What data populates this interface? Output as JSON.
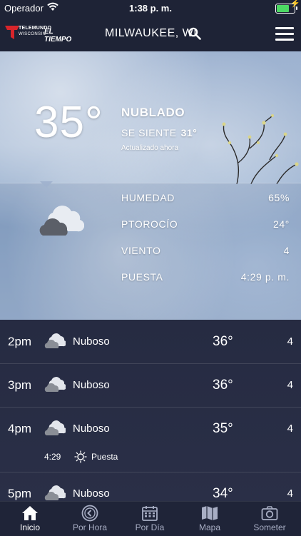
{
  "status": {
    "carrier": "Operador",
    "time": "1:38 p. m."
  },
  "header": {
    "brand_top": "TELEMUNDO",
    "brand_bottom": "WISCONSIN",
    "brand_right": "EL TIEMPO",
    "location": "MILWAUKEE, WI"
  },
  "current": {
    "temperature": "35°",
    "condition": "NUBLADO",
    "feels_label": "SE SIENTE",
    "feels_value": "31°",
    "updated": "Actualizado ahora"
  },
  "details": [
    {
      "label": "HUMEDAD",
      "value": "65%"
    },
    {
      "label": "PTOROCÍO",
      "value": "24°"
    },
    {
      "label": "VIENTO",
      "value": "4"
    },
    {
      "label": "PUESTA",
      "value": "4:29 p. m."
    }
  ],
  "hourly": [
    {
      "hour": "2pm",
      "icon": "cloudy-icon",
      "condition": "Nuboso",
      "temp": "36°",
      "wind": "4"
    },
    {
      "hour": "3pm",
      "icon": "cloudy-icon",
      "condition": "Nuboso",
      "temp": "36°",
      "wind": "4"
    },
    {
      "hour": "4pm",
      "icon": "cloudy-icon",
      "condition": "Nuboso",
      "temp": "35°",
      "wind": "4"
    },
    {
      "hour": "5pm",
      "icon": "cloudy-icon",
      "condition": "Nuboso",
      "temp": "34°",
      "wind": "4"
    }
  ],
  "sunset_event": {
    "time": "4:29",
    "label": "Puesta",
    "icon": "sunset-icon"
  },
  "tabs": [
    {
      "label": "Inicio",
      "icon": "home-icon",
      "active": true
    },
    {
      "label": "Por Hora",
      "icon": "clock-back-icon",
      "active": false
    },
    {
      "label": "Por Día",
      "icon": "calendar-icon",
      "active": false
    },
    {
      "label": "Mapa",
      "icon": "map-icon",
      "active": false
    },
    {
      "label": "Someter",
      "icon": "camera-icon",
      "active": false
    }
  ],
  "colors": {
    "header_bg": "#1e2336",
    "list_bg": "#262b42",
    "battery": "#4cd964",
    "logo_red": "#d8252b"
  }
}
